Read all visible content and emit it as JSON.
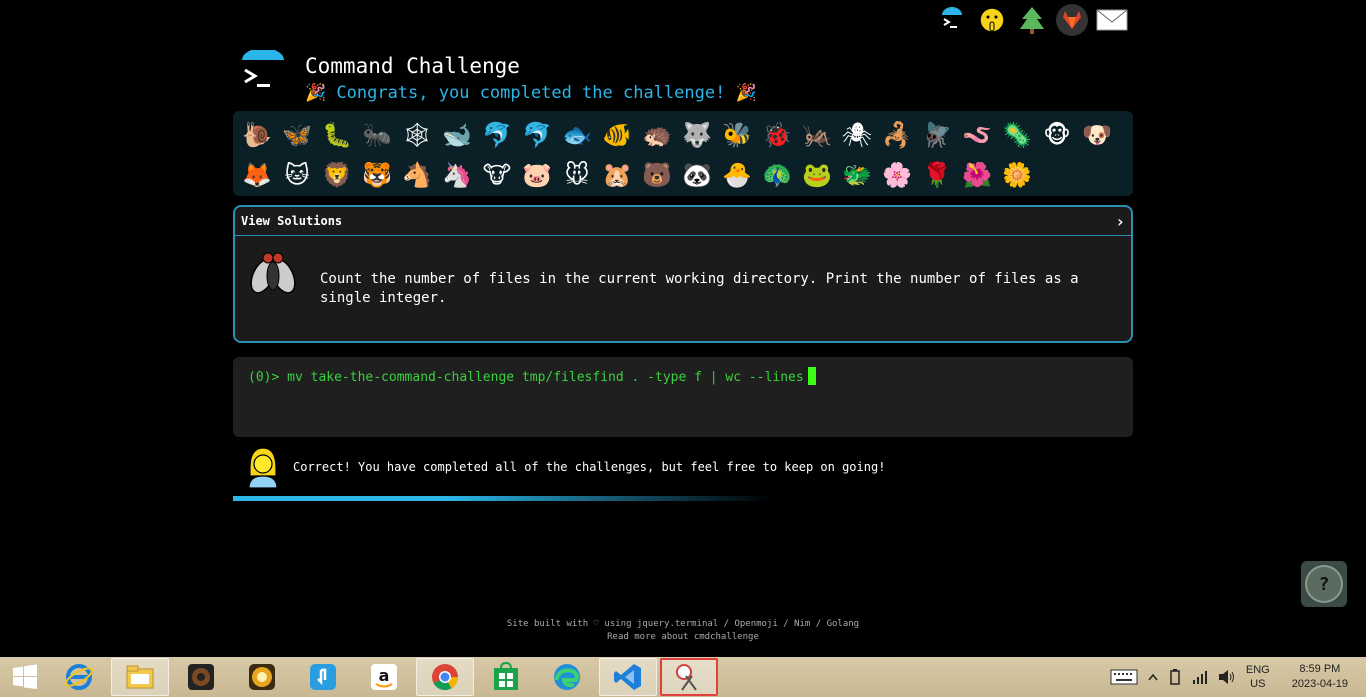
{
  "header": {
    "title": "Command Challenge",
    "subtitle": "🎉 Congrats, you completed the challenge! 🎉"
  },
  "top_icons": [
    "terminal-icon",
    "shush-face-icon",
    "tree-icon",
    "gitlab-icon",
    "mail-icon"
  ],
  "badges": [
    "🐌",
    "🦋",
    "🐛",
    "🐜",
    "🕸",
    "🐋",
    "🐬",
    "🐬",
    "🐟",
    "🐠",
    "🦔",
    "🐺",
    "🐝",
    "🐞",
    "🦗",
    "🕷",
    "🦂",
    "🪰",
    "🪱",
    "🦠",
    "🐵",
    "🐶",
    "🦊",
    "🐱",
    "🦁",
    "🐯",
    "🐴",
    "🦄",
    "🐮",
    "🐷",
    "🐭",
    "🐹",
    "🐻",
    "🐼",
    "🐣",
    "🦚",
    "🐸",
    "🐲",
    "🌸",
    "🌹",
    "🌺",
    "🌼"
  ],
  "solutions": {
    "header": "View Solutions",
    "arrow": "›",
    "task": "Count the number of files in the current working directory. Print the number of files as a single integer."
  },
  "terminal": {
    "prompt": "(0)>",
    "command": " mv take-the-command-challenge tmp/filesfind . -type f | wc --lines"
  },
  "result": {
    "message": "Correct! You have completed all of the challenges, but feel free to keep on going!"
  },
  "footer": {
    "line1": "Site built with ♡ using jquery.terminal / Openmoji / Nim / Golang",
    "line2": "Read more about cmdchallenge"
  },
  "fab": {
    "label": "?"
  },
  "taskbar": {
    "apps": [
      "internet-explorer-icon",
      "file-explorer-icon",
      "speaker-app-icon",
      "app-icon",
      "touch-app-icon",
      "amazon-icon",
      "chrome-icon",
      "store-icon",
      "edge-icon",
      "vscode-icon",
      "snipping-tool-icon"
    ],
    "lang_line1": "ENG",
    "lang_line2": "US",
    "time": "8:59 PM",
    "date": "2023-04-19"
  },
  "colors": {
    "accent": "#2cb5e8",
    "terminal_green": "#39d13f",
    "panel_bg": "#0a1f26"
  }
}
